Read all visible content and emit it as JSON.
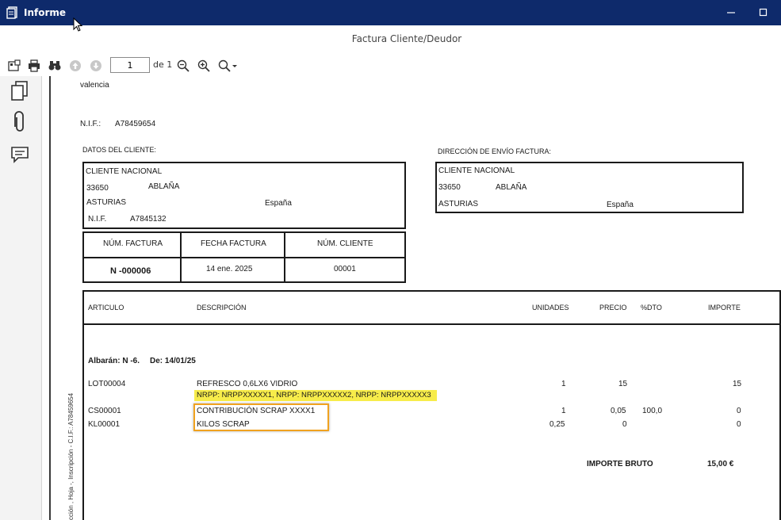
{
  "window": {
    "title": "Informe",
    "document_title": "Factura Cliente/Deudor"
  },
  "toolbar": {
    "page_value": "1",
    "page_of": "de 1"
  },
  "invoice": {
    "city": "valencia",
    "nif_label": "N.I.F.:",
    "nif_value": "A78459654",
    "client_section_label": "DATOS DEL CLIENTE:",
    "shipping_section_label": "DIRECCIÓN DE ENVÍO FACTURA:",
    "client": {
      "name": "CLIENTE NACIONAL",
      "postal_code": "33650",
      "town": "ABLAÑA",
      "province": "ASTURIAS",
      "country": "España",
      "nif_label": "N.I.F.",
      "nif": "A7845132"
    },
    "shipping": {
      "name": "CLIENTE NACIONAL",
      "postal_code": "33650",
      "town": "ABLAÑA",
      "province": "ASTURIAS",
      "country": "España"
    },
    "meta_headers": {
      "invoice_number": "NÚM. FACTURA",
      "invoice_date": "FECHA FACTURA",
      "client_number": "NÚM. CLIENTE"
    },
    "meta_values": {
      "invoice_number": "N -000006",
      "invoice_date": "14 ene. 2025",
      "client_number": "00001"
    },
    "table_headers": {
      "article": "ARTICULO",
      "description": "DESCRIPCIÓN",
      "units": "UNIDADES",
      "price": "PRECIO",
      "discount": "%DTO",
      "amount": "IMPORTE"
    },
    "delivery_note": "Albarán: N -6.",
    "delivery_date": "De: 14/01/25",
    "lines": [
      {
        "article": "LOT00004",
        "description": "REFRESCO 0,6LX6 VIDRIO",
        "units": "1",
        "price": "15",
        "discount": "",
        "amount": "15"
      },
      {
        "article": "CS00001",
        "description": "CONTRIBUCIÓN SCRAP XXXX1",
        "units": "1",
        "price": "0,05",
        "discount": "100,0",
        "amount": "0"
      },
      {
        "article": "KL00001",
        "description": "KILOS SCRAP",
        "units": "0,25",
        "price": "0",
        "discount": "",
        "amount": "0"
      }
    ],
    "nrpp_line": "NRPP: NRPPXXXXX1, NRPP: NRPPXXXXX2, NRPP: NRPPXXXXX3",
    "gross_label": "IMPORTE BRUTO",
    "gross_value": "15,00 €",
    "side_legend": "cción , Hoja -, Inscripción - C.I.F.: A78459654"
  },
  "colors": {
    "titlebar": "#0e2a6b",
    "highlight_yellow": "#f7ec4a",
    "highlight_orange": "#f0a21f"
  }
}
